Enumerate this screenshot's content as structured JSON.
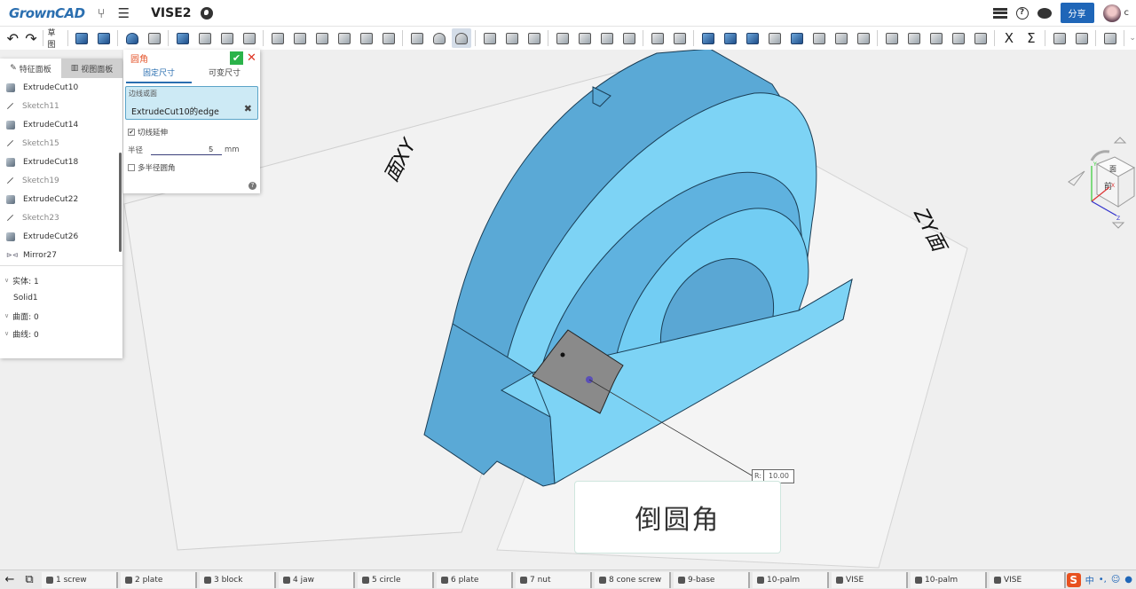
{
  "app": {
    "logo": "GrownCAD",
    "doc_title": "VISE2",
    "share_label": "分享",
    "user_initial": "c"
  },
  "toolbar": {
    "undo": "undo-icon",
    "redo": "redo-icon",
    "sketch_label": "草图",
    "groups": [
      [
        "extrude",
        "revolve"
      ],
      [
        "sweep",
        "loft"
      ],
      [
        "extrude-cut",
        "revolve-cut",
        "sweep-cut",
        "loft-cut"
      ],
      [
        "boolean",
        "draft",
        "split",
        "hole",
        "rib",
        "shell"
      ],
      [
        "chamfer",
        "fillet-variable",
        "fillet"
      ],
      [
        "mirror",
        "move",
        "thicken"
      ],
      [
        "pattern-linear",
        "pattern-circular",
        "pattern-curve",
        "pattern-fill"
      ],
      [
        "plane",
        "axis"
      ],
      [
        "surface-extrude",
        "surface-loft",
        "surface-sweep",
        "surface-offset",
        "surface-fill",
        "surface-patch",
        "surface-trim",
        "surface-extend"
      ],
      [
        "curve-spline",
        "curve-project",
        "curve-helix",
        "curve-arc",
        "curve-spiral"
      ],
      [
        "variable",
        "formula"
      ],
      [
        "measure",
        "appearance"
      ],
      [
        "view-mode"
      ]
    ],
    "variable_glyph": "X",
    "formula_glyph": "Σ"
  },
  "left_panel": {
    "tabs": [
      {
        "label": "特征面板",
        "icon": "edit-icon",
        "active": true
      },
      {
        "label": "视图面板",
        "icon": "map-icon",
        "active": false
      }
    ],
    "features": [
      {
        "name": "ExtrudeCut10",
        "type": "cut"
      },
      {
        "name": "Sketch11",
        "type": "sketch"
      },
      {
        "name": "ExtrudeCut14",
        "type": "cut"
      },
      {
        "name": "Sketch15",
        "type": "sketch"
      },
      {
        "name": "ExtrudeCut18",
        "type": "cut"
      },
      {
        "name": "Sketch19",
        "type": "sketch"
      },
      {
        "name": "ExtrudeCut22",
        "type": "cut"
      },
      {
        "name": "Sketch23",
        "type": "sketch"
      },
      {
        "name": "ExtrudeCut26",
        "type": "cut"
      },
      {
        "name": "Mirror27",
        "type": "mirror"
      }
    ],
    "bodies": {
      "solids_label": "实体: 1",
      "solid_item": "Solid1",
      "surfaces_label": "曲面: 0",
      "curves_label": "曲线: 0"
    }
  },
  "fillet_panel": {
    "title": "圆角",
    "tabs": [
      "固定尺寸",
      "可变尺寸"
    ],
    "active_tab": 0,
    "edge_label": "边线或面",
    "edge_value": "ExtrudeCut10的edge",
    "tangent_label": "切线延伸",
    "tangent_checked": true,
    "radius_label": "半径",
    "radius_value": "5",
    "radius_unit": "mm",
    "multi_radius_label": "多半径圆角",
    "multi_radius_checked": false
  },
  "viewport": {
    "plane_xy_label": "面XY",
    "plane_zy_label": "ZY面",
    "dimension_prefix": "R:",
    "dimension_value": "10.00",
    "caption": "倒圆角",
    "model_color": "#6ec6ef",
    "selected_face_color": "#8a8a8a"
  },
  "navcube": {
    "faces": [
      "前",
      "上",
      "右"
    ],
    "axes": [
      "X",
      "Y",
      "Z"
    ]
  },
  "taskbar": {
    "tabs": [
      {
        "label": "1 screw",
        "icon": "part"
      },
      {
        "label": "2 plate",
        "icon": "part"
      },
      {
        "label": "3 block",
        "icon": "part"
      },
      {
        "label": "4 jaw",
        "icon": "part"
      },
      {
        "label": "5 circle",
        "icon": "part"
      },
      {
        "label": "6 plate",
        "icon": "part"
      },
      {
        "label": "7 nut",
        "icon": "part"
      },
      {
        "label": "8 cone screw",
        "icon": "part"
      },
      {
        "label": "9-base",
        "icon": "part"
      },
      {
        "label": "10-palm",
        "icon": "part"
      },
      {
        "label": "VISE",
        "icon": "assembly"
      },
      {
        "label": "10-palm",
        "icon": "drawing"
      },
      {
        "label": "VISE",
        "icon": "drawing"
      }
    ],
    "tray": [
      "S",
      "中",
      "•,",
      "☺",
      "🎤"
    ]
  }
}
